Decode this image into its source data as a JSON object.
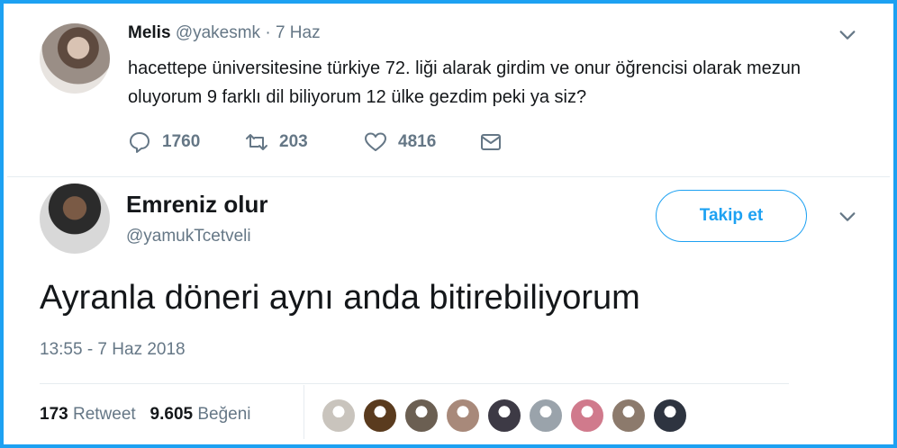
{
  "quoted_tweet": {
    "name": "Melis",
    "handle": "@yakesmk",
    "separator": "·",
    "date": "7 Haz",
    "text": "hacettepe üniversitesine türkiye 72. liği alarak girdim ve onur öğrencisi olarak mezun oluyorum 9 farklı dil biliyorum 12 ülke gezdim peki ya siz?",
    "replies": "1760",
    "retweets": "203",
    "likes": "4816"
  },
  "main_tweet": {
    "name": "Emreniz olur",
    "handle": "@yamukTcetveli",
    "follow_label": "Takip et",
    "text": "Ayranla döneri aynı anda bitirebiliyorum",
    "timestamp": "13:55 - 7 Haz 2018",
    "retweet_count": "173",
    "retweet_label": "Retweet",
    "like_count": "9.605",
    "like_label": "Beğeni"
  },
  "likers": [
    {
      "color": "#c9c4bd"
    },
    {
      "color": "#5a3b1e"
    },
    {
      "color": "#6b5f52"
    },
    {
      "color": "#a8897a"
    },
    {
      "color": "#3d3a45"
    },
    {
      "color": "#9aa3ab"
    },
    {
      "color": "#d07a8c"
    },
    {
      "color": "#8c7a6c"
    },
    {
      "color": "#2e3440"
    }
  ],
  "colors": {
    "accent": "#1da1f2",
    "muted": "#657786",
    "text": "#14171a"
  }
}
